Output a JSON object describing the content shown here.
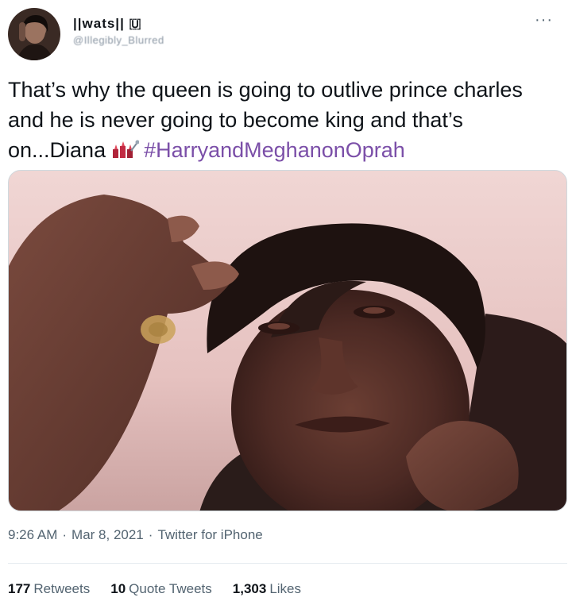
{
  "user": {
    "display_name": "||wats|| 🇺",
    "handle": "@Illegibly_Blurred",
    "avatar": "avatar-photo"
  },
  "more_icon": "more-icon",
  "tweet": {
    "text_main": "That’s why the queen is going to outlive prince charles and he is never going to become king and that’s on...Diana",
    "emoji": "lipstick-emoji",
    "hashtag": "#HarryandMeghanonOprah"
  },
  "media": {
    "description": "meme photo"
  },
  "meta": {
    "time": "9:26 AM",
    "separator": "·",
    "date": "Mar 8, 2021",
    "app": "Twitter for iPhone"
  },
  "stats": {
    "retweets_count": "177",
    "retweets_label": "Retweets",
    "quotes_count": "10",
    "quotes_label": "Quote Tweets",
    "likes_count": "1,303",
    "likes_label": "Likes"
  },
  "colors": {
    "hashtag": "#7b4fa8",
    "meta_text": "#536471",
    "text": "#0f1419"
  }
}
